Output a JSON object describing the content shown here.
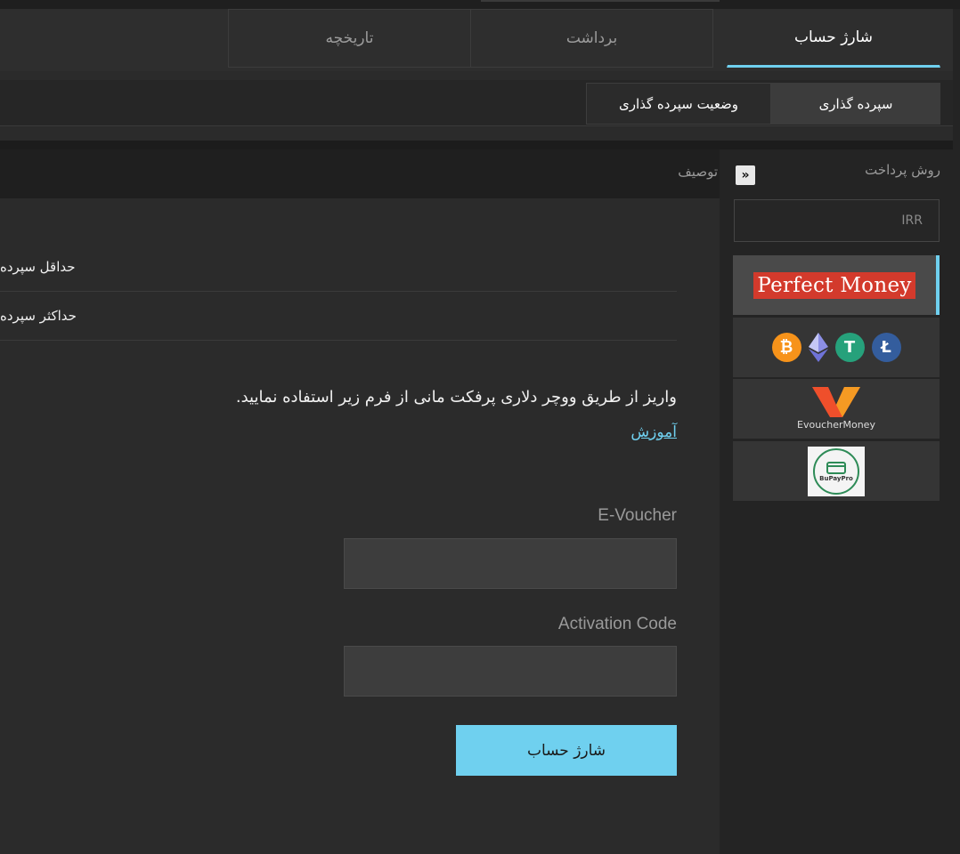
{
  "tabs": {
    "charge": "شارژ حساب",
    "withdraw": "برداشت",
    "history": "تاریخچه"
  },
  "subtabs": {
    "deposit": "سپرده گذاری",
    "status": "وضعیت سپرده گذاری"
  },
  "sidebar": {
    "title": "روش پرداخت",
    "collapse_icon": "double-chevron-right-icon",
    "currency": "IRR",
    "methods": {
      "perfect_money": "Perfect Money",
      "evoucher": "EvoucherMoney",
      "other_logo": "BuPayPro"
    }
  },
  "content": {
    "header": "توصیف",
    "min_deposit": "حداقل سپرده",
    "max_deposit": "حداکثر سپرده",
    "description": "واریز از طریق ووچر دلاری پرفکت مانی از فرم زیر استفاده نمایید.",
    "learn_link": "آموزش",
    "evoucher_label": "E-Voucher",
    "evoucher_value": "",
    "activation_label": "Activation Code",
    "activation_value": "",
    "submit": "شارژ حساب"
  },
  "colors": {
    "accent": "#6fd0ef",
    "pm_red": "#d33a2c",
    "background": "#2b2b2b"
  }
}
